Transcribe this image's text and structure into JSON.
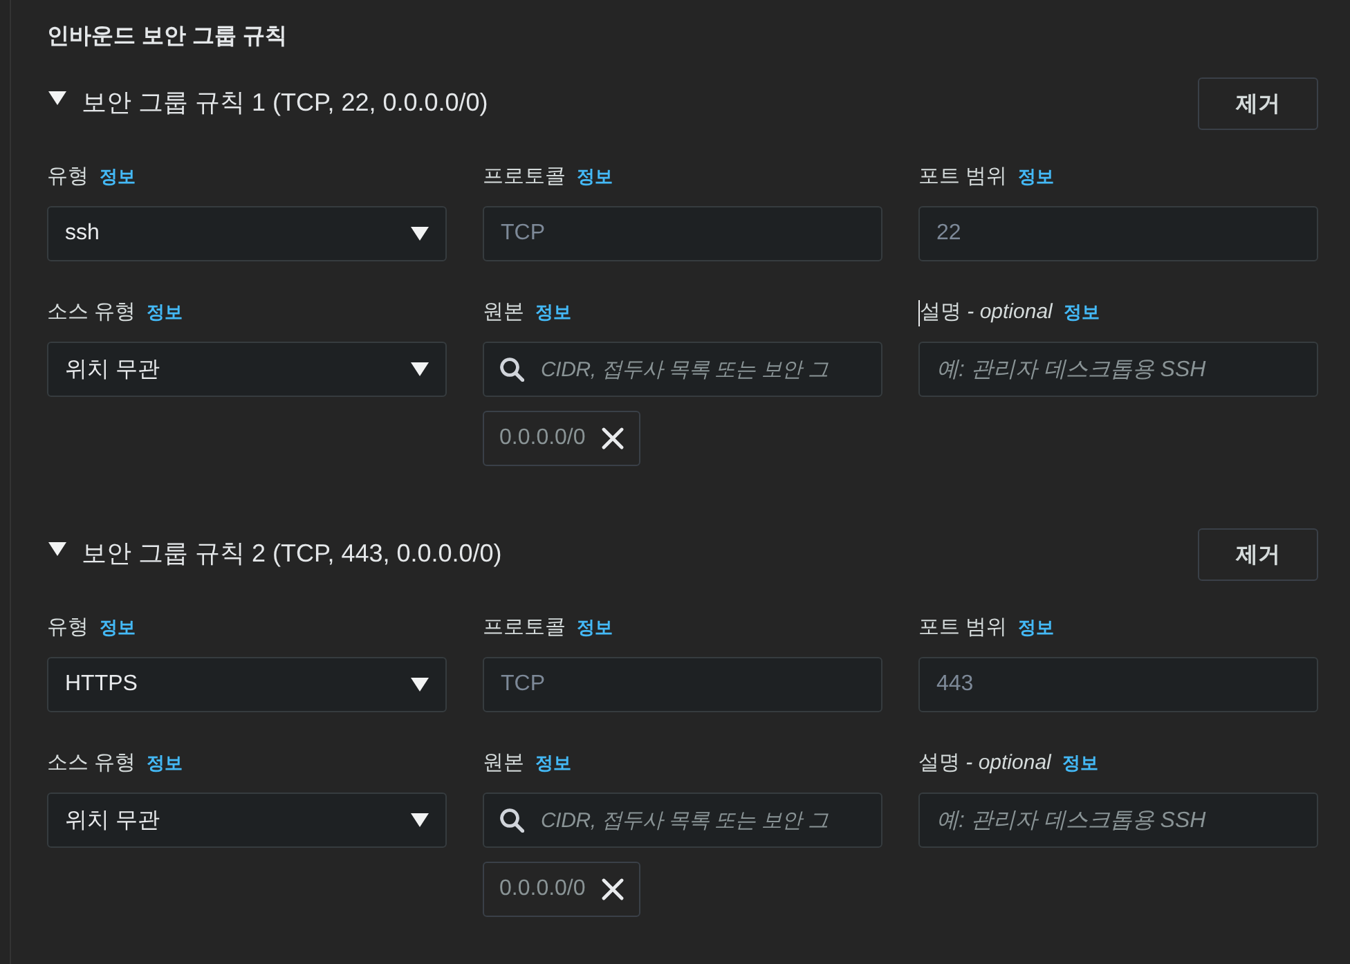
{
  "section": {
    "title": "인바운드 보안 그룹 규칙"
  },
  "rules": [
    {
      "title": "보안 그룹 규칙 1 (TCP, 22, 0.0.0.0/0)",
      "expanded": true,
      "remove_button": "제거",
      "fields": [
        {
          "kind": "select",
          "label": "유형",
          "info": "정보",
          "value": "ssh",
          "disabled": false,
          "text_cursor": false
        },
        {
          "kind": "text",
          "label": "프로토콜",
          "info": "정보",
          "value": "TCP",
          "disabled": true,
          "text_cursor": false
        },
        {
          "kind": "text",
          "label": "포트 범위",
          "info": "정보",
          "value": "22",
          "disabled": true,
          "text_cursor": false
        },
        {
          "kind": "select",
          "label": "소스 유형",
          "info": "정보",
          "value": "위치 무관",
          "disabled": false,
          "text_cursor": false
        },
        {
          "kind": "search",
          "label": "원본",
          "info": "정보",
          "placeholder": "CIDR, 접두사 목록 또는 보안 그",
          "tokens": [
            {
              "label": "0.0.0.0/0"
            }
          ],
          "disabled": false,
          "text_cursor": false
        },
        {
          "kind": "text",
          "label": "설명 *- optional*",
          "info": "정보",
          "placeholder": "예: 관리자 데스크톱용 SSH",
          "disabled": false,
          "text_cursor": true
        }
      ]
    },
    {
      "title": "보안 그룹 규칙 2 (TCP, 443, 0.0.0.0/0)",
      "expanded": true,
      "remove_button": "제거",
      "fields": [
        {
          "kind": "select",
          "label": "유형",
          "info": "정보",
          "value": "HTTPS",
          "disabled": false,
          "text_cursor": false
        },
        {
          "kind": "text",
          "label": "프로토콜",
          "info": "정보",
          "value": "TCP",
          "disabled": true,
          "text_cursor": false
        },
        {
          "kind": "text",
          "label": "포트 범위",
          "info": "정보",
          "value": "443",
          "disabled": true,
          "text_cursor": false
        },
        {
          "kind": "select",
          "label": "소스 유형",
          "info": "정보",
          "value": "위치 무관",
          "disabled": false,
          "text_cursor": false
        },
        {
          "kind": "search",
          "label": "원본",
          "info": "정보",
          "placeholder": "CIDR, 접두사 목록 또는 보안 그",
          "tokens": [
            {
              "label": "0.0.0.0/0"
            }
          ],
          "disabled": false,
          "text_cursor": false
        },
        {
          "kind": "text",
          "label": "설명 *- optional*",
          "info": "정보",
          "placeholder": "예: 관리자 데스크톱용 SSH",
          "disabled": false,
          "text_cursor": false
        }
      ]
    }
  ]
}
